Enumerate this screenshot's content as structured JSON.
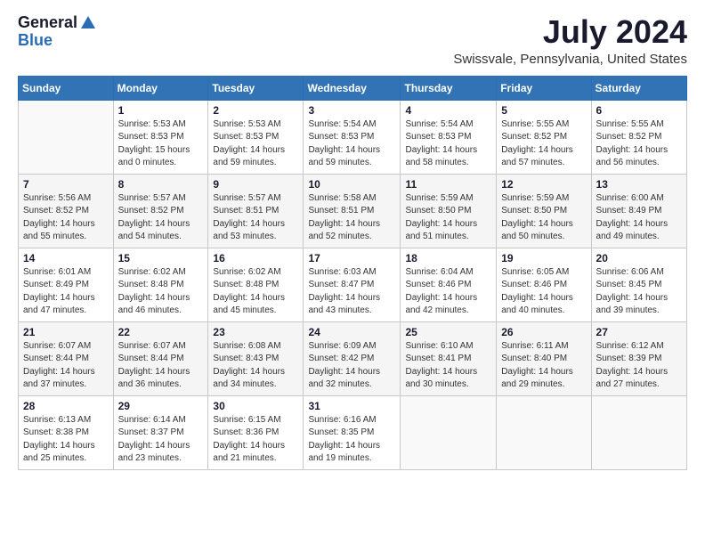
{
  "header": {
    "logo_general": "General",
    "logo_blue": "Blue",
    "month": "July 2024",
    "location": "Swissvale, Pennsylvania, United States"
  },
  "weekdays": [
    "Sunday",
    "Monday",
    "Tuesday",
    "Wednesday",
    "Thursday",
    "Friday",
    "Saturday"
  ],
  "weeks": [
    [
      {
        "day": "",
        "info": ""
      },
      {
        "day": "1",
        "info": "Sunrise: 5:53 AM\nSunset: 8:53 PM\nDaylight: 15 hours\nand 0 minutes."
      },
      {
        "day": "2",
        "info": "Sunrise: 5:53 AM\nSunset: 8:53 PM\nDaylight: 14 hours\nand 59 minutes."
      },
      {
        "day": "3",
        "info": "Sunrise: 5:54 AM\nSunset: 8:53 PM\nDaylight: 14 hours\nand 59 minutes."
      },
      {
        "day": "4",
        "info": "Sunrise: 5:54 AM\nSunset: 8:53 PM\nDaylight: 14 hours\nand 58 minutes."
      },
      {
        "day": "5",
        "info": "Sunrise: 5:55 AM\nSunset: 8:52 PM\nDaylight: 14 hours\nand 57 minutes."
      },
      {
        "day": "6",
        "info": "Sunrise: 5:55 AM\nSunset: 8:52 PM\nDaylight: 14 hours\nand 56 minutes."
      }
    ],
    [
      {
        "day": "7",
        "info": "Sunrise: 5:56 AM\nSunset: 8:52 PM\nDaylight: 14 hours\nand 55 minutes."
      },
      {
        "day": "8",
        "info": "Sunrise: 5:57 AM\nSunset: 8:52 PM\nDaylight: 14 hours\nand 54 minutes."
      },
      {
        "day": "9",
        "info": "Sunrise: 5:57 AM\nSunset: 8:51 PM\nDaylight: 14 hours\nand 53 minutes."
      },
      {
        "day": "10",
        "info": "Sunrise: 5:58 AM\nSunset: 8:51 PM\nDaylight: 14 hours\nand 52 minutes."
      },
      {
        "day": "11",
        "info": "Sunrise: 5:59 AM\nSunset: 8:50 PM\nDaylight: 14 hours\nand 51 minutes."
      },
      {
        "day": "12",
        "info": "Sunrise: 5:59 AM\nSunset: 8:50 PM\nDaylight: 14 hours\nand 50 minutes."
      },
      {
        "day": "13",
        "info": "Sunrise: 6:00 AM\nSunset: 8:49 PM\nDaylight: 14 hours\nand 49 minutes."
      }
    ],
    [
      {
        "day": "14",
        "info": "Sunrise: 6:01 AM\nSunset: 8:49 PM\nDaylight: 14 hours\nand 47 minutes."
      },
      {
        "day": "15",
        "info": "Sunrise: 6:02 AM\nSunset: 8:48 PM\nDaylight: 14 hours\nand 46 minutes."
      },
      {
        "day": "16",
        "info": "Sunrise: 6:02 AM\nSunset: 8:48 PM\nDaylight: 14 hours\nand 45 minutes."
      },
      {
        "day": "17",
        "info": "Sunrise: 6:03 AM\nSunset: 8:47 PM\nDaylight: 14 hours\nand 43 minutes."
      },
      {
        "day": "18",
        "info": "Sunrise: 6:04 AM\nSunset: 8:46 PM\nDaylight: 14 hours\nand 42 minutes."
      },
      {
        "day": "19",
        "info": "Sunrise: 6:05 AM\nSunset: 8:46 PM\nDaylight: 14 hours\nand 40 minutes."
      },
      {
        "day": "20",
        "info": "Sunrise: 6:06 AM\nSunset: 8:45 PM\nDaylight: 14 hours\nand 39 minutes."
      }
    ],
    [
      {
        "day": "21",
        "info": "Sunrise: 6:07 AM\nSunset: 8:44 PM\nDaylight: 14 hours\nand 37 minutes."
      },
      {
        "day": "22",
        "info": "Sunrise: 6:07 AM\nSunset: 8:44 PM\nDaylight: 14 hours\nand 36 minutes."
      },
      {
        "day": "23",
        "info": "Sunrise: 6:08 AM\nSunset: 8:43 PM\nDaylight: 14 hours\nand 34 minutes."
      },
      {
        "day": "24",
        "info": "Sunrise: 6:09 AM\nSunset: 8:42 PM\nDaylight: 14 hours\nand 32 minutes."
      },
      {
        "day": "25",
        "info": "Sunrise: 6:10 AM\nSunset: 8:41 PM\nDaylight: 14 hours\nand 30 minutes."
      },
      {
        "day": "26",
        "info": "Sunrise: 6:11 AM\nSunset: 8:40 PM\nDaylight: 14 hours\nand 29 minutes."
      },
      {
        "day": "27",
        "info": "Sunrise: 6:12 AM\nSunset: 8:39 PM\nDaylight: 14 hours\nand 27 minutes."
      }
    ],
    [
      {
        "day": "28",
        "info": "Sunrise: 6:13 AM\nSunset: 8:38 PM\nDaylight: 14 hours\nand 25 minutes."
      },
      {
        "day": "29",
        "info": "Sunrise: 6:14 AM\nSunset: 8:37 PM\nDaylight: 14 hours\nand 23 minutes."
      },
      {
        "day": "30",
        "info": "Sunrise: 6:15 AM\nSunset: 8:36 PM\nDaylight: 14 hours\nand 21 minutes."
      },
      {
        "day": "31",
        "info": "Sunrise: 6:16 AM\nSunset: 8:35 PM\nDaylight: 14 hours\nand 19 minutes."
      },
      {
        "day": "",
        "info": ""
      },
      {
        "day": "",
        "info": ""
      },
      {
        "day": "",
        "info": ""
      }
    ]
  ]
}
